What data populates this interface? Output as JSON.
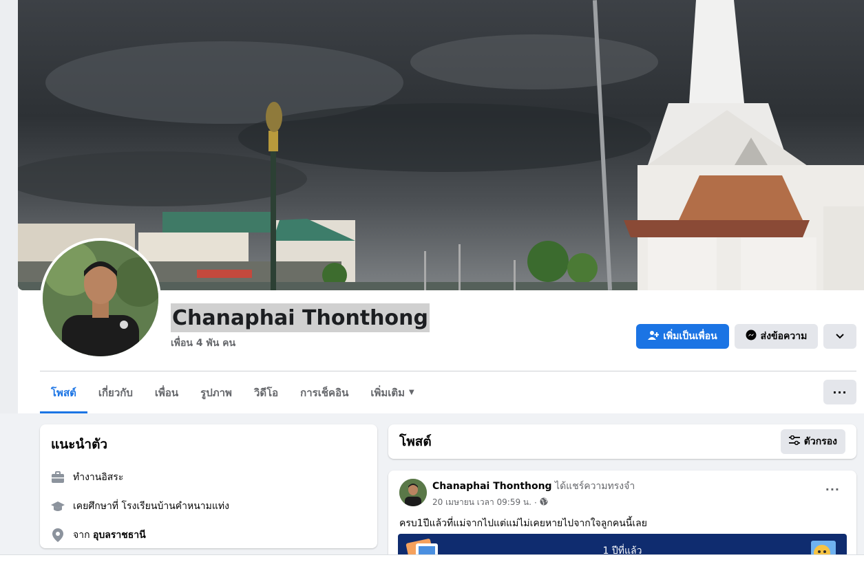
{
  "profile": {
    "name": "Chanaphai Thonthong",
    "friends": "เพื่อน 4 พัน คน"
  },
  "actions": {
    "add_friend": "เพิ่มเป็นเพื่อน",
    "message": "ส่งข้อความ"
  },
  "tabs": [
    {
      "label": "โพสต์"
    },
    {
      "label": "เกี่ยวกับ"
    },
    {
      "label": "เพื่อน"
    },
    {
      "label": "รูปภาพ"
    },
    {
      "label": "วิดีโอ"
    },
    {
      "label": "การเช็คอิน"
    },
    {
      "label": "เพิ่มเติม"
    }
  ],
  "intro": {
    "title": "แนะนำตัว",
    "work": "ทำงานอิสระ",
    "study_prefix": "เคยศึกษาที่",
    "study_place": "โรงเรียนบ้านคำหนามแท่ง",
    "from_prefix": "จาก",
    "from_place": "อุบลราชธานี"
  },
  "posts": {
    "title": "โพสต์",
    "filter_label": "ตัวกรอง",
    "first": {
      "author": "Chanaphai Thonthong",
      "action": "ได้แชร์ความทรงจำ",
      "time": "20 เมษายน เวลา 09:59 น.",
      "dot": "·",
      "text": "ครบ1ปีแล้วที่แม่จากไปแต่แม่ไม่เคยหายไปจากใจลูกคนนี้เลย",
      "memory_label": "1 ปีที่แล้ว"
    }
  },
  "colors": {
    "accent": "#1b74e4",
    "memory_bg": "#0f2c6f"
  }
}
